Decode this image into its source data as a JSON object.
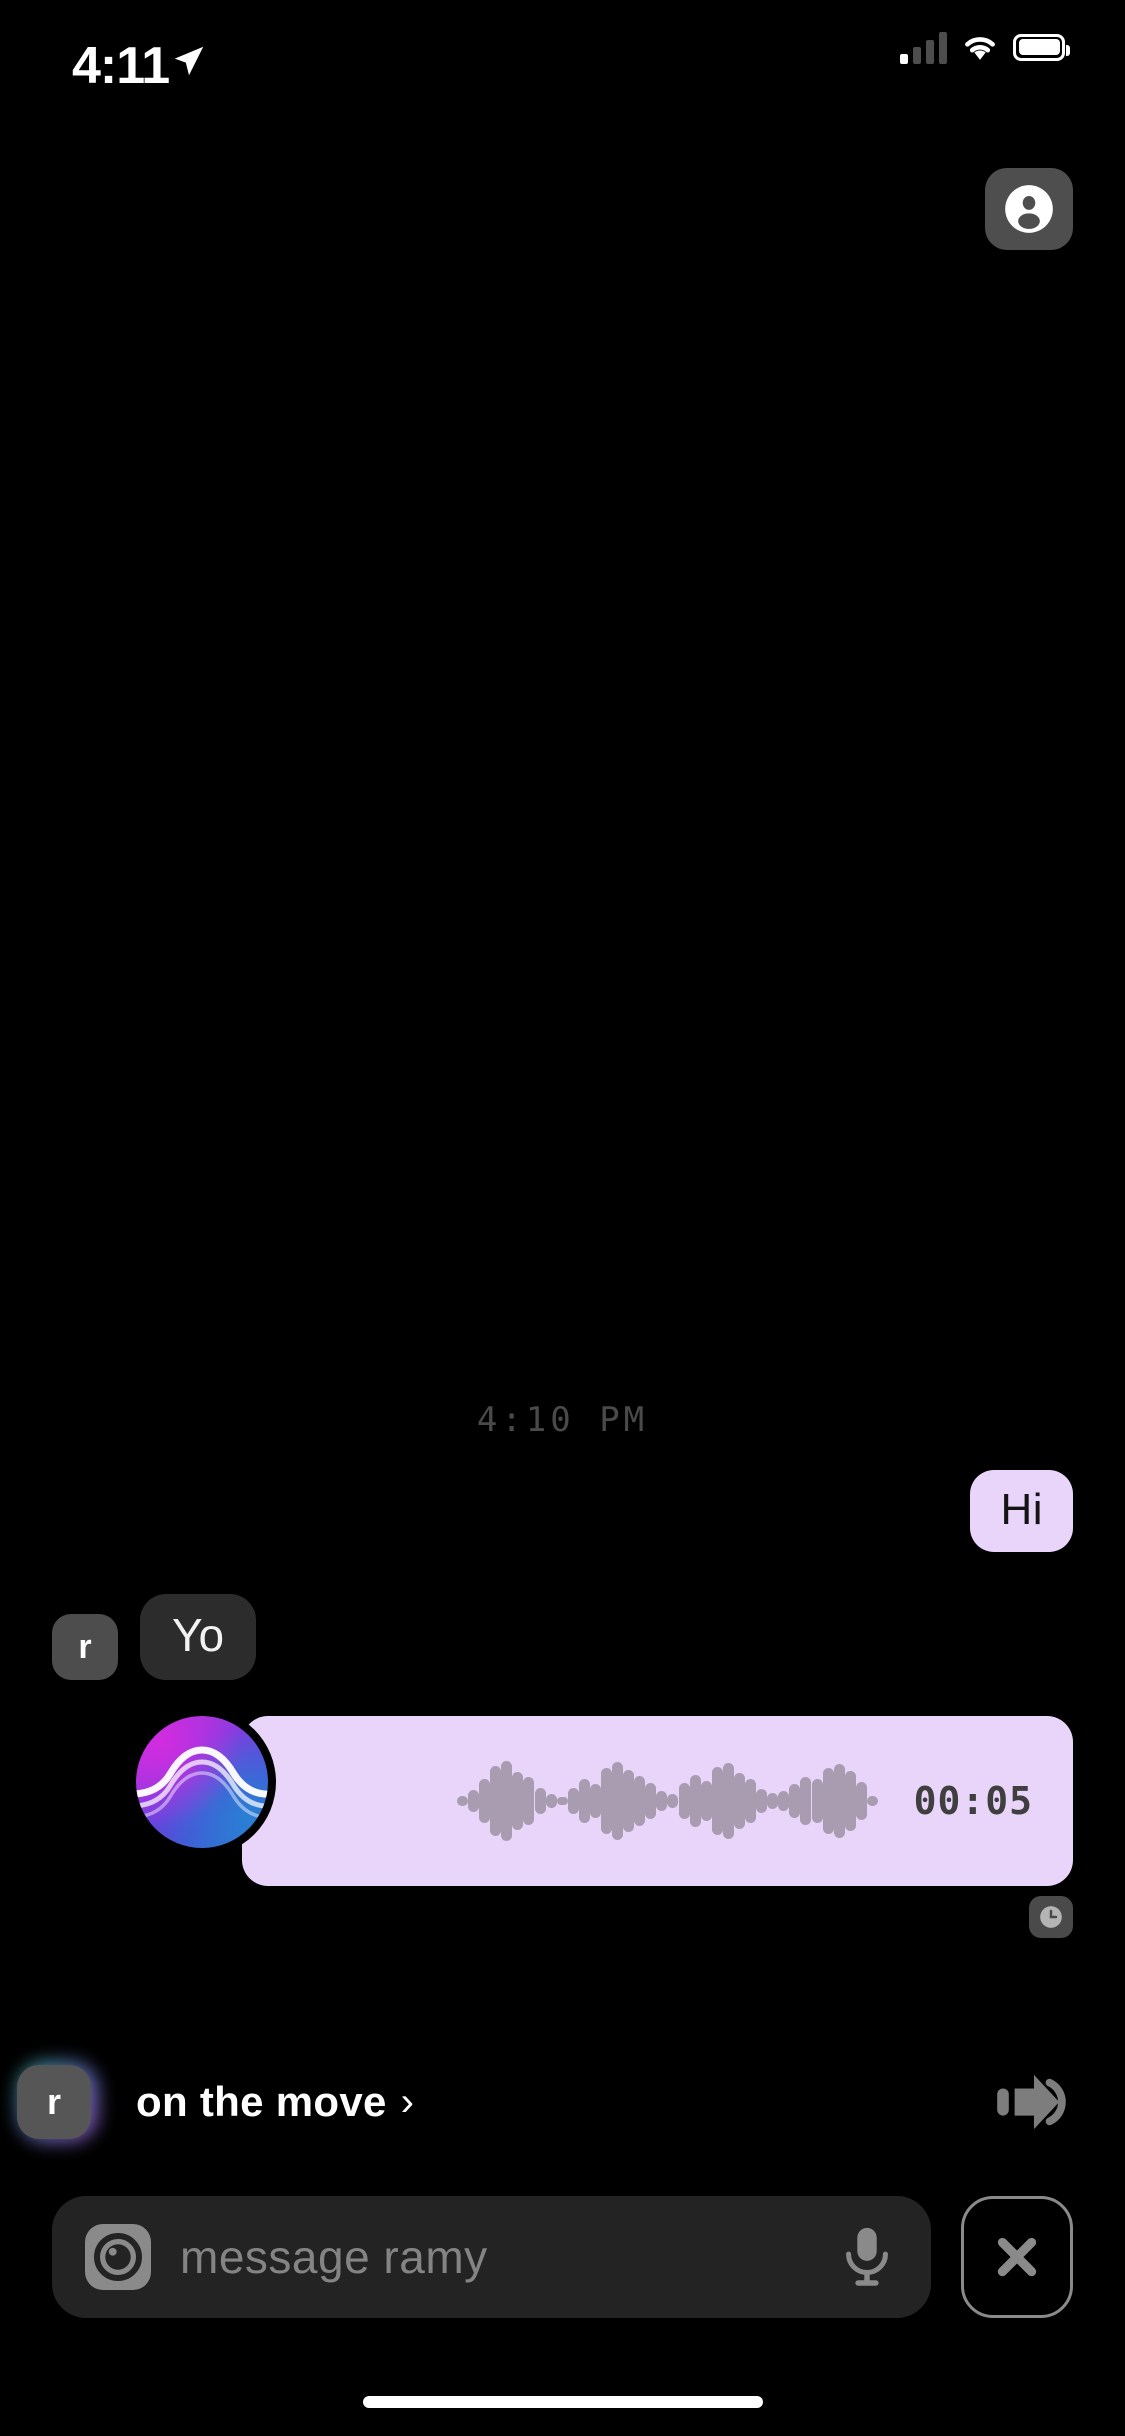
{
  "status_bar": {
    "time": "4:11",
    "location_icon": "location-arrow-icon",
    "signal_icon": "cellular-signal-icon",
    "wifi_icon": "wifi-icon",
    "battery_icon": "battery-icon"
  },
  "header": {
    "profile_button_label": "",
    "profile_icon": "person-circle-icon"
  },
  "chat": {
    "day_divider": "4:10 PM",
    "messages": [
      {
        "id": "msg-hi",
        "direction": "outgoing",
        "type": "text",
        "text": "Hi"
      },
      {
        "id": "msg-yo",
        "direction": "incoming",
        "type": "text",
        "text": "Yo",
        "avatar_initial": "r"
      },
      {
        "id": "msg-voice",
        "direction": "outgoing",
        "type": "voice",
        "duration": "00:05",
        "avatar": "audio-wave-avatar",
        "status_icon": "clock-icon",
        "waveform": [
          10,
          22,
          44,
          70,
          80,
          58,
          48,
          26,
          14,
          8,
          26,
          44,
          34,
          66,
          78,
          62,
          50,
          36,
          20,
          14,
          36,
          52,
          40,
          68,
          76,
          56,
          44,
          24,
          16,
          20,
          34,
          48,
          44,
          66,
          74,
          60,
          38,
          10
        ]
      }
    ]
  },
  "presence": {
    "avatar_initial": "r",
    "label": "on the move",
    "chevron": "›",
    "forward_icon": "skip-forward-icon"
  },
  "composer": {
    "camera_icon": "camera-icon",
    "placeholder": "message ramy",
    "input_value": "",
    "mic_icon": "microphone-icon",
    "close_icon": "close-x-icon"
  },
  "colors": {
    "background": "#000000",
    "outgoing_bubble": "#e9d5fa",
    "incoming_bubble": "#2c2c2c",
    "avatar_gray": "#4d4d4d",
    "muted_text": "#848484",
    "divider_text": "#4a4a4a",
    "waveform_bar": "#a99bb0"
  }
}
